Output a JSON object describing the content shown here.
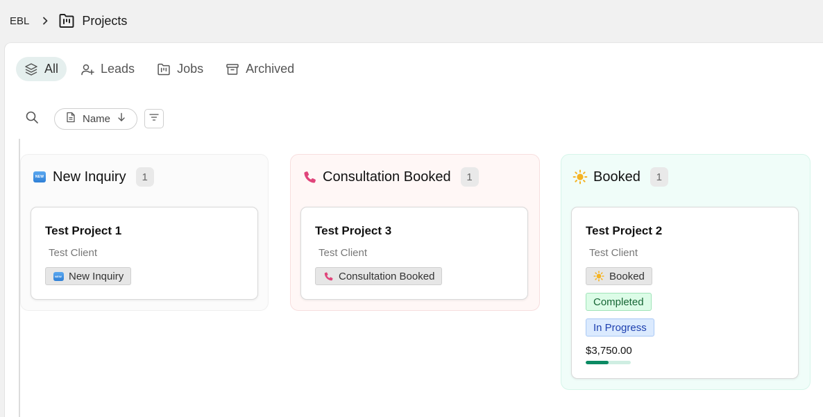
{
  "breadcrumb": {
    "org": "EBL",
    "title": "Projects"
  },
  "tabs": [
    {
      "label": "All",
      "icon": "layers-icon",
      "active": true
    },
    {
      "label": "Leads",
      "icon": "user-plus-icon",
      "active": false
    },
    {
      "label": "Jobs",
      "icon": "folder-kanban-icon",
      "active": false
    },
    {
      "label": "Archived",
      "icon": "archive-icon",
      "active": false
    }
  ],
  "toolbar": {
    "sort_label": "Name",
    "sort_direction": "descending"
  },
  "new_badge_text": "NEW",
  "columns": [
    {
      "title": "New Inquiry",
      "icon": "new-badge-icon",
      "count": "1",
      "cards": [
        {
          "title": "Test Project 1",
          "client": "Test Client",
          "tags": [
            {
              "label": "New Inquiry",
              "icon": "new-badge-icon"
            }
          ]
        }
      ]
    },
    {
      "title": "Consultation Booked",
      "icon": "phone-icon",
      "count": "1",
      "cards": [
        {
          "title": "Test Project 3",
          "client": "Test Client",
          "tags": [
            {
              "label": "Consultation Booked",
              "icon": "phone-icon"
            }
          ]
        }
      ]
    },
    {
      "title": "Booked",
      "icon": "sun-icon",
      "count": "1",
      "cards": [
        {
          "title": "Test Project 2",
          "client": "Test Client",
          "tags": [
            {
              "label": "Booked",
              "icon": "sun-icon"
            },
            {
              "label": "Completed"
            },
            {
              "label": "In Progress"
            }
          ],
          "amount": "$3,750.00",
          "progress": 0.5
        }
      ]
    }
  ],
  "colors": {
    "accent": "#0b8a63",
    "active_tab_bg": "#e5efee",
    "new_inquiry_bg": "#fbfbfb",
    "consultation_bg": "#fff7f6",
    "booked_bg": "#f0fdf9",
    "phone_icon": "#e0457b",
    "sun_icon": "#f5b323",
    "completed_tag": "#dcfce7",
    "in_progress_tag": "#dbeafe"
  }
}
